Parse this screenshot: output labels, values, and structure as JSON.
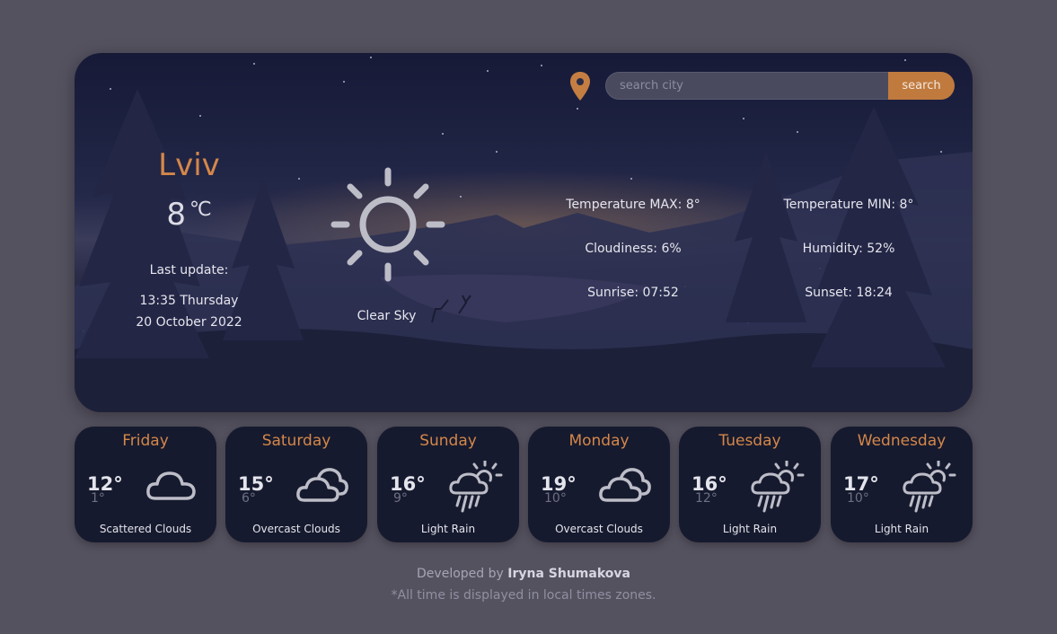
{
  "search": {
    "placeholder": "search city",
    "button_label": "search"
  },
  "current": {
    "city": "Lviv",
    "temperature": "8",
    "unit": "℃",
    "last_update_label": "Last update:",
    "time": "13:35 Thursday",
    "date": "20 October 2022",
    "condition": "Clear Sky",
    "icon": "sun-icon",
    "stats": {
      "temp_max": "Temperature MAX: 8°",
      "temp_min": "Temperature MIN: 8°",
      "cloudiness": "Cloudiness: 6%",
      "humidity": "Humidity: 52%",
      "sunrise": "Sunrise: 07:52",
      "sunset": "Sunset: 18:24"
    }
  },
  "forecast": [
    {
      "day": "Friday",
      "high": "12°",
      "low": "1°",
      "desc": "Scattered Clouds",
      "icon": "cloud-icon"
    },
    {
      "day": "Saturday",
      "high": "15°",
      "low": "6°",
      "desc": "Overcast Clouds",
      "icon": "clouds-icon"
    },
    {
      "day": "Sunday",
      "high": "16°",
      "low": "9°",
      "desc": "Light Rain",
      "icon": "sun-rain-icon"
    },
    {
      "day": "Monday",
      "high": "19°",
      "low": "10°",
      "desc": "Overcast Clouds",
      "icon": "clouds-icon"
    },
    {
      "day": "Tuesday",
      "high": "16°",
      "low": "12°",
      "desc": "Light Rain",
      "icon": "sun-rain-icon"
    },
    {
      "day": "Wednesday",
      "high": "17°",
      "low": "10°",
      "desc": "Light Rain",
      "icon": "sun-rain-icon"
    }
  ],
  "footer": {
    "developed_by": "Developed by",
    "author": "Iryna Shumakova",
    "note": "*All time is displayed in local times zones."
  },
  "colors": {
    "accent": "#d4874a",
    "button": "#c07a3e",
    "card": "#161a2e",
    "background": "#555260"
  }
}
